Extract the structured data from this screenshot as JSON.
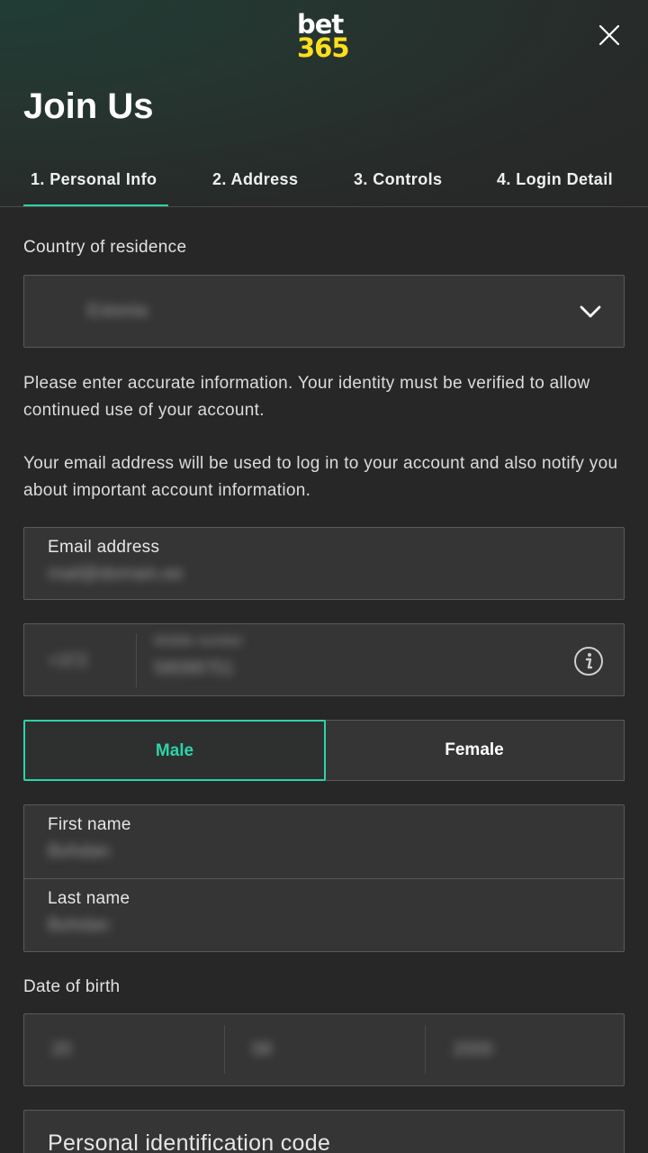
{
  "brand": {
    "logo_line1": "bet",
    "logo_line2": "365",
    "logo_yellow": "#ffdf1b",
    "accent": "#2ed3a8"
  },
  "header": {
    "title": "Join Us",
    "close_icon": "close-icon"
  },
  "tabs": [
    {
      "label": "1.  Personal Info",
      "active": true
    },
    {
      "label": "2.  Address"
    },
    {
      "label": "3.  Controls"
    },
    {
      "label": "4.  Login Detail"
    }
  ],
  "country": {
    "label": "Country of residence",
    "value": "Estonia",
    "icon": "chevron-down-icon"
  },
  "info": {
    "p1": "Please enter accurate information. Your identity must be verified to allow continued use of your account.",
    "p2": "Your email address will be used to log in to your account and also notify you about important account information."
  },
  "email": {
    "label": "Email address",
    "value": "mail@domain.ee"
  },
  "phone": {
    "code": "+372",
    "label": "Mobile number",
    "value": "58098751",
    "icon": "info-icon"
  },
  "gender": {
    "male": "Male",
    "female": "Female",
    "selected": "Male"
  },
  "names": {
    "first_label": "First name",
    "first_value": "Bohdan",
    "last_label": "Last name",
    "last_value": "Bohdan"
  },
  "dob": {
    "label": "Date of birth",
    "day": "20",
    "month": "08",
    "year": "2000"
  },
  "pic": {
    "label": "Personal identification code"
  }
}
